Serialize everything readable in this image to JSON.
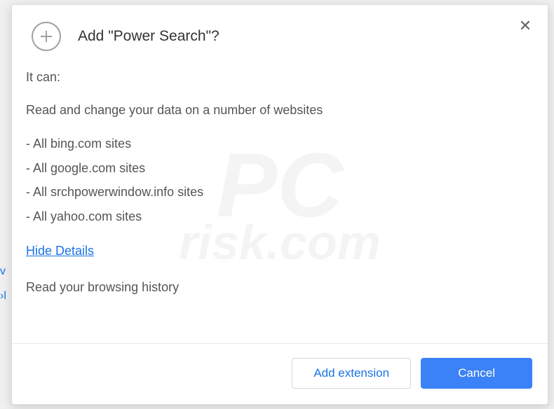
{
  "dialog": {
    "title": "Add \"Power Search\"?",
    "close_label": "✕"
  },
  "permissions": {
    "intro": "It can:",
    "data_access": "Read and change your data on a number of websites",
    "sites": [
      "All bing.com sites",
      "All google.com sites",
      "All srchpowerwindow.info sites",
      "All yahoo.com sites"
    ],
    "toggle": "Hide Details",
    "history": "Read your browsing history"
  },
  "actions": {
    "add": "Add extension",
    "cancel": "Cancel"
  },
  "watermark": {
    "main": "PC",
    "sub": "risk.com"
  }
}
